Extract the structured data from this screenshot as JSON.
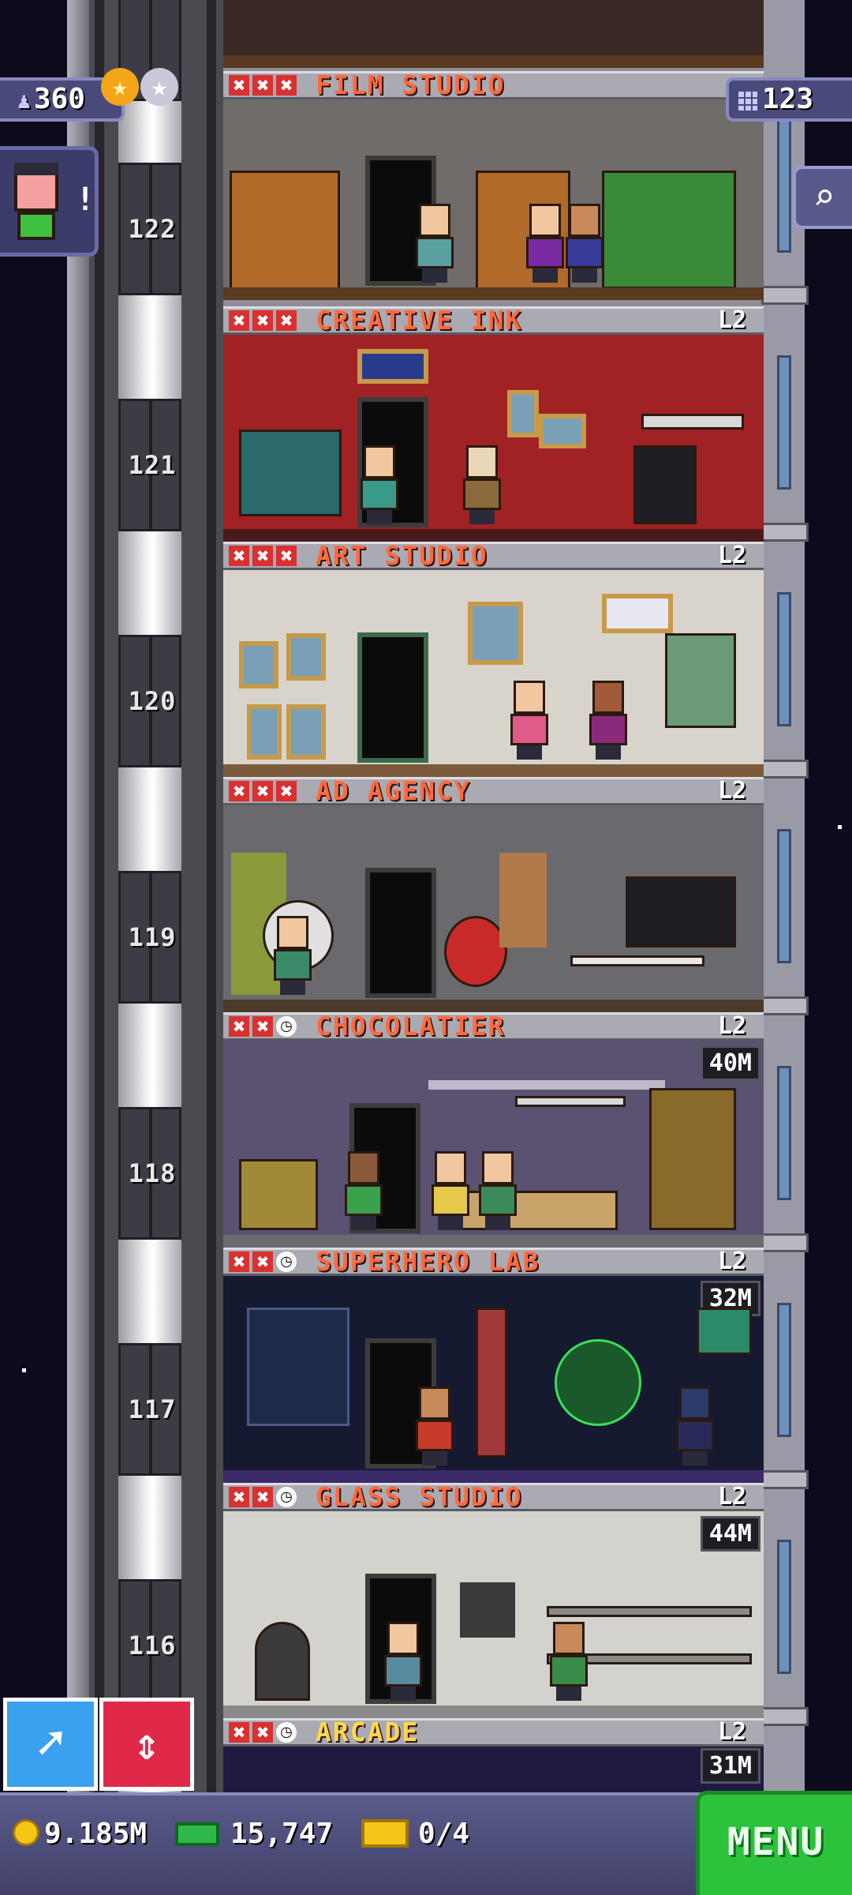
{
  "hud": {
    "population": "360",
    "population_icon": "person-icon",
    "floors_count": "123",
    "floors_icon": "grid-icon",
    "stars": [
      "★",
      "★"
    ],
    "vip_alert": "!",
    "search_icon": "magnifier-icon"
  },
  "floors": [
    {
      "number": "122",
      "name": "FILM STUDIO",
      "level": "",
      "timer": "",
      "name_color": "orange",
      "status": [
        "x",
        "x",
        "x"
      ]
    },
    {
      "number": "121",
      "name": "CREATIVE INK",
      "level": "L2",
      "timer": "",
      "name_color": "orange",
      "status": [
        "x",
        "x",
        "x"
      ]
    },
    {
      "number": "120",
      "name": "ART STUDIO",
      "level": "L2",
      "timer": "",
      "name_color": "orange",
      "status": [
        "x",
        "x",
        "x"
      ]
    },
    {
      "number": "119",
      "name": "AD AGENCY",
      "level": "L2",
      "timer": "",
      "name_color": "orange",
      "status": [
        "x",
        "x",
        "x"
      ]
    },
    {
      "number": "118",
      "name": "CHOCOLATIER",
      "level": "L2",
      "timer": "40M",
      "name_color": "orange",
      "status": [
        "x",
        "x",
        "clock"
      ]
    },
    {
      "number": "117",
      "name": "SUPERHERO LAB",
      "level": "L2",
      "timer": "32M",
      "name_color": "orange",
      "status": [
        "x",
        "x",
        "clock"
      ]
    },
    {
      "number": "116",
      "name": "GLASS STUDIO",
      "level": "L2",
      "timer": "44M",
      "name_color": "orange",
      "status": [
        "x",
        "x",
        "clock"
      ]
    },
    {
      "number": "",
      "name": "ARCADE",
      "level": "L2",
      "timer": "31M",
      "name_color": "gold",
      "status": [
        "x",
        "x",
        "clock"
      ]
    }
  ],
  "bottom_bar": {
    "coins": "9.185M",
    "bux": "15,747",
    "tickets": "0/4",
    "menu_label": "MENU"
  },
  "buttons": {
    "rocket_icon": "rocket-icon",
    "elevator_icon": "elevator-arrows-icon"
  },
  "colors": {
    "label_orange": "#ff6a3d",
    "label_gold": "#ffd84a",
    "menu_green": "#2cc23c",
    "elevator_red": "#e02848",
    "rocket_blue": "#3aa0f0"
  }
}
